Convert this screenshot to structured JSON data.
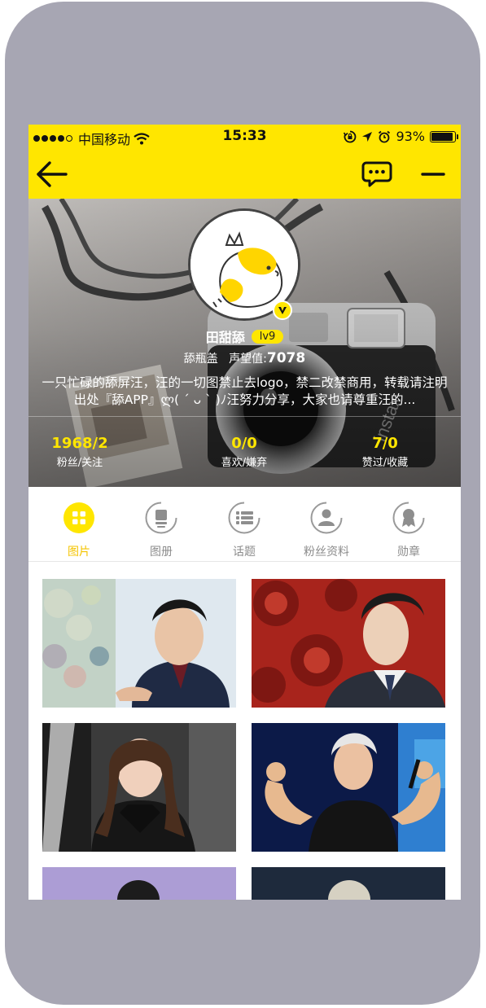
{
  "status_bar": {
    "carrier": "中国移动",
    "time": "15:33",
    "battery": "93%",
    "battery_level": 0.93
  },
  "nav": {
    "back_icon": "back-arrow-icon",
    "message_icon": "chat-bubble-icon",
    "more_icon": "minus-icon"
  },
  "profile": {
    "name": "田甜舔",
    "level": "lv9",
    "title": "舔瓶盖",
    "reputation_label": "声望值:",
    "reputation_value": "7078",
    "bio": "一只忙碌的舔屏汪，汪的一切图禁止去logo，禁二改禁商用，转载请注明出处『舔APP』ლ( ´ ᴗ ` )ﾉ汪努力分享，大家也请尊重汪的...",
    "verified_icon": "verified-v-icon",
    "avatar_icon": "chick-avatar-icon"
  },
  "stats": [
    {
      "value": "1968/2",
      "label": "粉丝/关注"
    },
    {
      "value": "0/0",
      "label": "喜欢/嫌弃"
    },
    {
      "value": "7/0",
      "label": "赞过/收藏"
    }
  ],
  "tabs": [
    {
      "label": "图片",
      "icon": "grid-icon",
      "active": true
    },
    {
      "label": "图册",
      "icon": "album-icon",
      "active": false
    },
    {
      "label": "话题",
      "icon": "topic-list-icon",
      "active": false
    },
    {
      "label": "粉丝资料",
      "icon": "person-icon",
      "active": false
    },
    {
      "label": "勋章",
      "icon": "medal-icon",
      "active": false
    }
  ],
  "colors": {
    "accent": "#ffe600",
    "active_tab": "#f4c400",
    "frame": "#a7a6b3",
    "inactive_text": "#8c8c8c"
  }
}
